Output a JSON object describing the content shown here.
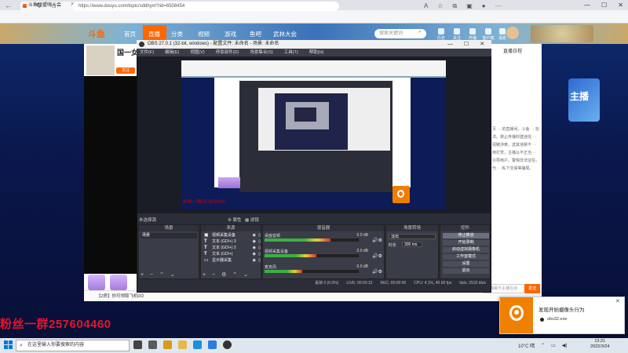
{
  "browser": {
    "tab_title": "斗鱼联盟嗨斗会",
    "url": "https://www.douyu.com/topic/sddhyxt?rid=6508454",
    "nav": [
      "←",
      "→",
      "↻",
      "⌂"
    ],
    "window_controls": [
      "—",
      "☐",
      "✕"
    ]
  },
  "site": {
    "logo": "斗鱼",
    "nav": [
      "首页",
      "直播",
      "分类",
      "视频",
      "游戏",
      "鱼吧",
      "武林大会"
    ],
    "search_placeholder": "搜索关键词",
    "header_icons": [
      "历史",
      "关注",
      "开播",
      "客户端",
      "消息"
    ],
    "streamer_name": "国一女",
    "follow_label": "关注",
    "sidebar_title": "直播日程",
    "sidebar_text": "灭 ·  - 的直播间。斗鱼 · · 玩法。禁止传播封建迷信 · · 招赌涉黄，送其违禁不 · · 用打赏，主播以不正当 · · 引导用户。警惕非法征信，代 · · 私下交易等骗局。",
    "banner_text": "主播",
    "bottom_text": "【2房】你可领取飞机0/2",
    "bottom_warn": "暂无",
    "chat_placeholder": "发弹幕与主播互动",
    "send_label": "发送",
    "fan_group": "粉丝一群257604460"
  },
  "obs": {
    "title": "OBS 27.0.1 (32-bit, windows) - 配置文件: 未命名 - 场景: 未命名",
    "menu": [
      "文件(F)",
      "编辑(E)",
      "视图(V)",
      "停靠部件(D)",
      "场景集合(S)",
      "工具(T)",
      "帮助(H)"
    ],
    "window_controls": [
      "—",
      "☐",
      "✕"
    ],
    "scene_bar_label": "未选择源",
    "preview_fan_text": "粉丝一群257604460",
    "docks": {
      "scenes": {
        "title": "场景",
        "items": [
          "场景"
        ]
      },
      "sources": {
        "title": "来源",
        "items": [
          "视频采集设备",
          "文本 (GDI+) 3",
          "文本 (GDI+) 2",
          "文本 (GDI+)",
          "显示器采集"
        ]
      },
      "mixer": {
        "title": "混音器",
        "rows": [
          {
            "name": "桌面音频",
            "db": "0.0 dB"
          },
          {
            "name": "视频采集设备",
            "db": "0.0 dB"
          },
          {
            "name": "麦克风",
            "db": "0.0 dB"
          }
        ]
      },
      "transitions": {
        "title": "场景转场",
        "type": "淡出",
        "duration_label": "时长",
        "duration": "300 ms"
      },
      "controls": {
        "title": "控件",
        "buttons": [
          "停止推流",
          "开始录制",
          "启动虚拟摄像机",
          "工作室模式",
          "设置",
          "退出"
        ]
      }
    },
    "status": [
      "丢帧 0 (0.0%)",
      "LIVE: 00:00:15",
      "REC: 00:00:00",
      "CPU: 4.1%, 40.00 fps",
      "kb/s: 2533 kb/s"
    ]
  },
  "toast": {
    "title": "发现开始摄像头行为",
    "app": "obs32.exe",
    "close": "✕"
  },
  "taskbar": {
    "search_placeholder": "在这里输入你要搜索的内容",
    "weather": "10°C 晴",
    "time": "13:21",
    "date": "2022/3/24"
  }
}
